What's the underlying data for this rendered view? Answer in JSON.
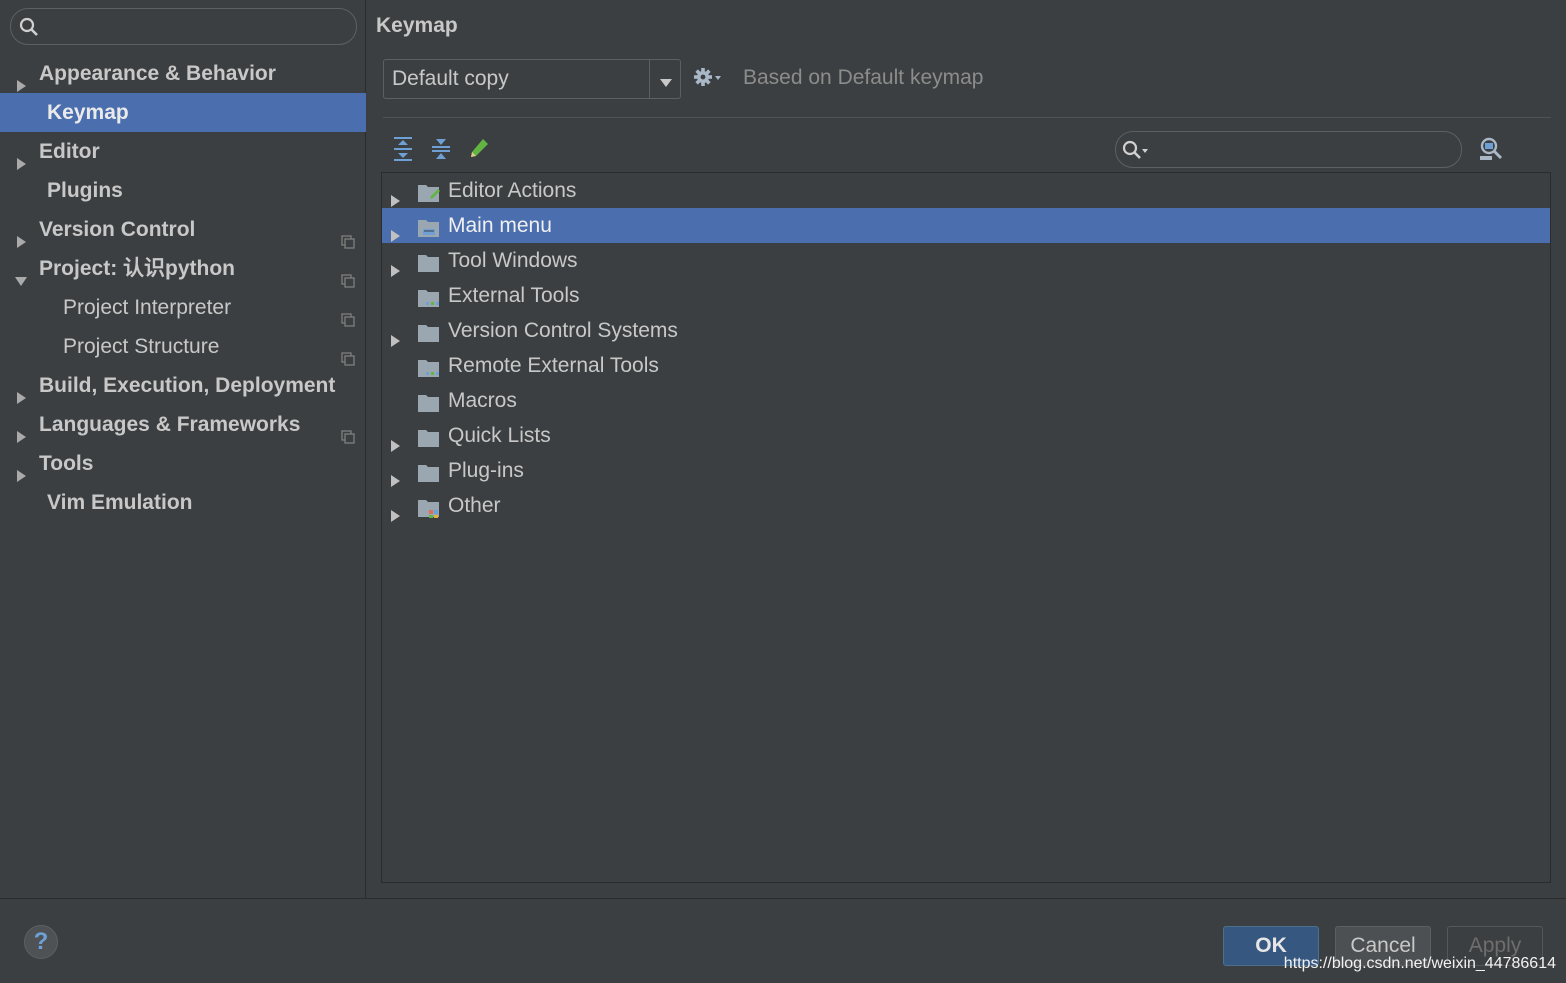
{
  "sidebar": {
    "search": {
      "placeholder": "",
      "icon": "search-icon"
    },
    "items": [
      {
        "label": "Appearance & Behavior",
        "expandable": true,
        "expanded": false,
        "bold": true,
        "indent": 0,
        "project_icon": false,
        "selected": false
      },
      {
        "label": "Keymap",
        "expandable": false,
        "bold": true,
        "indent": 0,
        "project_icon": false,
        "selected": true
      },
      {
        "label": "Editor",
        "expandable": true,
        "expanded": false,
        "bold": true,
        "indent": 0,
        "project_icon": false,
        "selected": false
      },
      {
        "label": "Plugins",
        "expandable": false,
        "bold": true,
        "indent": 0,
        "project_icon": false,
        "selected": false
      },
      {
        "label": "Version Control",
        "expandable": true,
        "expanded": false,
        "bold": true,
        "indent": 0,
        "project_icon": true,
        "selected": false
      },
      {
        "label": "Project: 认识python",
        "expandable": true,
        "expanded": true,
        "bold": true,
        "indent": 0,
        "project_icon": true,
        "selected": false
      },
      {
        "label": "Project Interpreter",
        "expandable": false,
        "bold": false,
        "indent": 1,
        "project_icon": true,
        "selected": false
      },
      {
        "label": "Project Structure",
        "expandable": false,
        "bold": false,
        "indent": 1,
        "project_icon": true,
        "selected": false
      },
      {
        "label": "Build, Execution, Deployment",
        "expandable": true,
        "expanded": false,
        "bold": true,
        "indent": 0,
        "project_icon": false,
        "selected": false
      },
      {
        "label": "Languages & Frameworks",
        "expandable": true,
        "expanded": false,
        "bold": true,
        "indent": 0,
        "project_icon": true,
        "selected": false
      },
      {
        "label": "Tools",
        "expandable": true,
        "expanded": false,
        "bold": true,
        "indent": 0,
        "project_icon": false,
        "selected": false
      },
      {
        "label": "Vim Emulation",
        "expandable": false,
        "bold": true,
        "indent": 0,
        "project_icon": false,
        "selected": false
      }
    ]
  },
  "main": {
    "title": "Keymap",
    "keymap_select": {
      "value": "Default copy",
      "icon": "chevron-down-icon"
    },
    "gear_icon": "gear-icon",
    "based_on": "Based on Default keymap",
    "toolbar": [
      "expand-all-icon",
      "collapse-all-icon",
      "edit-pencil-icon"
    ],
    "tree_search": {
      "placeholder": "",
      "icon": "search-icon"
    },
    "find_shortcut_icon": "find-shortcut-icon",
    "tree": [
      {
        "label": "Editor Actions",
        "expandable": true,
        "icon": "editor-actions-folder",
        "selected": false
      },
      {
        "label": "Main menu",
        "expandable": true,
        "icon": "menu-folder",
        "selected": true
      },
      {
        "label": "Tool Windows",
        "expandable": true,
        "icon": "folder",
        "selected": false
      },
      {
        "label": "External Tools",
        "expandable": false,
        "icon": "tools-folder",
        "selected": false
      },
      {
        "label": "Version Control Systems",
        "expandable": true,
        "icon": "folder",
        "selected": false
      },
      {
        "label": "Remote External Tools",
        "expandable": false,
        "icon": "tools-folder",
        "selected": false
      },
      {
        "label": "Macros",
        "expandable": false,
        "icon": "folder",
        "selected": false
      },
      {
        "label": "Quick Lists",
        "expandable": true,
        "icon": "folder",
        "selected": false
      },
      {
        "label": "Plug-ins",
        "expandable": true,
        "icon": "folder",
        "selected": false
      },
      {
        "label": "Other",
        "expandable": true,
        "icon": "other-folder",
        "selected": false
      }
    ]
  },
  "footer": {
    "help_label": "?",
    "ok_label": "OK",
    "cancel_label": "Cancel",
    "apply_label": "Apply",
    "watermark": "https://blog.csdn.net/weixin_44786614"
  },
  "colors": {
    "background": "#3c3f41",
    "selection": "#4b6eaf",
    "text": "#c8c8c8",
    "ok_button": "#365880"
  }
}
